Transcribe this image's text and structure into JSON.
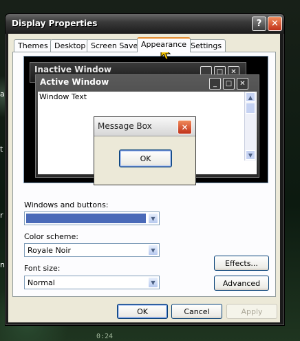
{
  "dialog": {
    "title": "Display Properties",
    "tabs": [
      {
        "label": "Themes"
      },
      {
        "label": "Desktop"
      },
      {
        "label": "Screen Saver"
      },
      {
        "label": "Appearance"
      },
      {
        "label": "Settings"
      }
    ],
    "active_tab": "Appearance"
  },
  "preview": {
    "inactive_title": "Inactive Window",
    "active_title": "Active Window",
    "window_text": "Window Text",
    "message_title": "Message Box",
    "ok_label": "OK"
  },
  "form": {
    "windows_buttons_label": "Windows and buttons:",
    "windows_buttons_swatch_color": "#4a6ab8",
    "color_scheme_label": "Color scheme:",
    "color_scheme_value": "Royale Noir",
    "font_size_label": "Font size:",
    "font_size_value": "Normal",
    "effects_label": "Effects...",
    "advanced_label": "Advanced"
  },
  "footer": {
    "ok_label": "OK",
    "cancel_label": "Cancel",
    "apply_label": "Apply"
  },
  "desktop": {
    "time_text": "0:24"
  },
  "colors": {
    "accent_tab": "#e68b2c",
    "close_red": "#c0321a"
  }
}
